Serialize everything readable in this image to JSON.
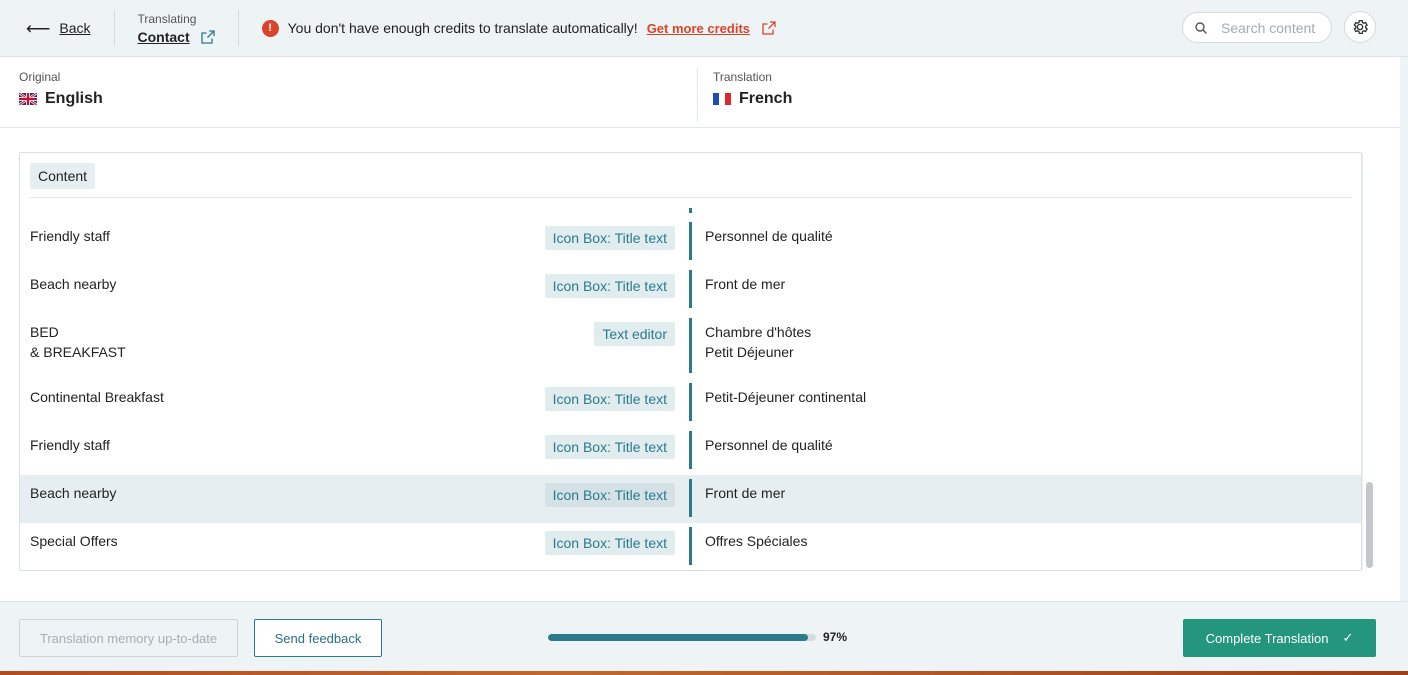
{
  "topbar": {
    "back_label": "Back",
    "translating_label": "Translating",
    "page_name": "Contact",
    "alert_text": "You don't have enough credits to translate automatically!",
    "alert_link": "Get more credits",
    "search_placeholder": "Search content"
  },
  "languages": {
    "original_label": "Original",
    "original_name": "English",
    "translation_label": "Translation",
    "translation_name": "French"
  },
  "section": {
    "title": "Content"
  },
  "rows": [
    {
      "original": "Friendly staff",
      "tag": "Icon Box: Title text",
      "translation": "Personnel de qualité"
    },
    {
      "original": "Beach nearby",
      "tag": "Icon Box: Title text",
      "translation": "Front de mer"
    },
    {
      "original_line1": "BED",
      "original_line2": "& BREAKFAST",
      "tag": "Text editor",
      "translation_line1": "Chambre d'hôtes",
      "translation_line2": "Petit Déjeuner"
    },
    {
      "original": "Continental Breakfast",
      "tag": "Icon Box: Title text",
      "translation": "Petit-Déjeuner continental"
    },
    {
      "original": "Friendly staff",
      "tag": "Icon Box: Title text",
      "translation": "Personnel de qualité"
    },
    {
      "original": "Beach nearby",
      "tag": "Icon Box: Title text",
      "translation": "Front de mer",
      "highlighted": true
    },
    {
      "original": "Special Offers",
      "tag": "Icon Box: Title text",
      "translation": "Offres Spéciales"
    }
  ],
  "footer": {
    "memory_label": "Translation memory up-to-date",
    "feedback_label": "Send feedback",
    "progress_value": 0.97,
    "progress_label": "97%",
    "complete_label": "Complete Translation"
  },
  "colors": {
    "accent": "#2a7a8c",
    "alert": "#d9452b",
    "complete": "#23967d"
  },
  "icons": [
    "back-arrow-icon",
    "external-link-icon",
    "alert-icon",
    "search-icon",
    "gear-icon",
    "uk-flag-icon",
    "france-flag-icon",
    "check-icon"
  ]
}
